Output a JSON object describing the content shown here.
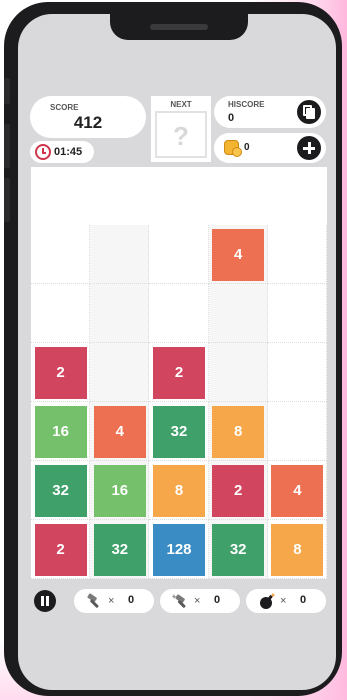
{
  "header": {
    "score_label": "SCORE",
    "score_value": "412",
    "timer": "01:45",
    "next_label": "NEXT",
    "next_value": "?",
    "hiscore_label": "HISCORE",
    "hiscore_value": "0",
    "coins_value": "0"
  },
  "board": {
    "columns": 5,
    "rows": 6,
    "tiles": [
      {
        "row": 0,
        "col": 3,
        "value": "4",
        "color": "#ee7052"
      },
      {
        "row": 2,
        "col": 0,
        "value": "2",
        "color": "#d2455f"
      },
      {
        "row": 2,
        "col": 2,
        "value": "2",
        "color": "#d2455f"
      },
      {
        "row": 3,
        "col": 0,
        "value": "16",
        "color": "#75c06a"
      },
      {
        "row": 3,
        "col": 1,
        "value": "4",
        "color": "#ee7052"
      },
      {
        "row": 3,
        "col": 2,
        "value": "32",
        "color": "#3fa06a"
      },
      {
        "row": 3,
        "col": 3,
        "value": "8",
        "color": "#f5a74a"
      },
      {
        "row": 4,
        "col": 0,
        "value": "32",
        "color": "#3fa06a"
      },
      {
        "row": 4,
        "col": 1,
        "value": "16",
        "color": "#75c06a"
      },
      {
        "row": 4,
        "col": 2,
        "value": "8",
        "color": "#f5a74a"
      },
      {
        "row": 4,
        "col": 3,
        "value": "2",
        "color": "#d2455f"
      },
      {
        "row": 4,
        "col": 4,
        "value": "4",
        "color": "#ee7052"
      },
      {
        "row": 5,
        "col": 0,
        "value": "2",
        "color": "#d2455f"
      },
      {
        "row": 5,
        "col": 1,
        "value": "32",
        "color": "#3fa06a"
      },
      {
        "row": 5,
        "col": 2,
        "value": "128",
        "color": "#3a8cc4"
      },
      {
        "row": 5,
        "col": 3,
        "value": "32",
        "color": "#3fa06a"
      },
      {
        "row": 5,
        "col": 4,
        "value": "8",
        "color": "#f5a74a"
      }
    ]
  },
  "powerups": [
    {
      "name": "hammer-icon",
      "times": "×",
      "count": "0"
    },
    {
      "name": "magic-hammer-icon",
      "times": "×",
      "count": "0"
    },
    {
      "name": "bomb-icon",
      "times": "×",
      "count": "0"
    }
  ]
}
